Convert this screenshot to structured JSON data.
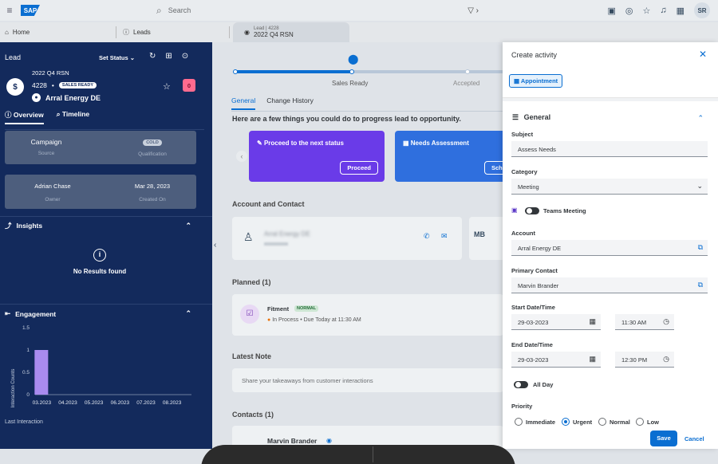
{
  "shell": {
    "logo": "SAP",
    "search_placeholder": "Search",
    "avatar": "SR"
  },
  "tabs": {
    "home": "Home",
    "leads": "Leads",
    "lead_small": "Lead | 4228",
    "lead_title": "2022 Q4 RSN"
  },
  "left": {
    "header": "Lead",
    "set_status": "Set Status",
    "lead_title": "2022 Q4 RSN",
    "lead_id": "4228",
    "status_badge": "SALES READY",
    "account": "Arral Energy DE",
    "count": "0",
    "tab_overview": "Overview",
    "tab_timeline": "Timeline",
    "campaign_value": "Campaign",
    "campaign_label": "Source",
    "qualification_value": "COLD",
    "qualification_label": "Qualification",
    "owner_value": "Adrian Chase",
    "owner_label": "Owner",
    "created_value": "Mar 28, 2023",
    "created_label": "Created On",
    "insights": "Insights",
    "no_results": "No Results found",
    "engagement": "Engagement",
    "last_interaction": "Last Interaction"
  },
  "chart_data": {
    "type": "bar",
    "categories": [
      "03.2023",
      "04.2023",
      "05.2023",
      "06.2023",
      "07.2023",
      "08.2023"
    ],
    "values": [
      1,
      0,
      0,
      0,
      0,
      0
    ],
    "ylabel": "Interaction Counts",
    "yticks": [
      "0",
      "0.5",
      "1",
      "1.5"
    ],
    "ylim": [
      0,
      1.5
    ],
    "bar_color": "#a98bef"
  },
  "mid": {
    "stage_current": "Sales Ready",
    "stage_next": "Accepted",
    "tab_general": "General",
    "tab_history": "Change History",
    "progress_heading": "Here are a few things you could do to progress lead to opportunity.",
    "action1_title": "Proceed to the next status",
    "action1_btn": "Proceed",
    "action2_title": "Needs Assessment",
    "action2_btn": "Sch",
    "account_contact": "Account and Contact",
    "account_name": "Arral Energy DE",
    "contact_initials": "MB",
    "planned": "Planned (1)",
    "planned_title": "Fitment",
    "planned_badge": "NORMAL",
    "planned_status": "In Process • Due Today at 11:30 AM",
    "latest_note": "Latest Note",
    "note_placeholder": "Share your takeaways from customer interactions",
    "contacts": "Contacts (1)",
    "contact_name": "Marvin Brander"
  },
  "dialog": {
    "title": "Create activity",
    "appointment": "Appointment",
    "general": "General",
    "subject_label": "Subject",
    "subject_value": "Assess Needs",
    "category_label": "Category",
    "category_value": "Meeting",
    "teams_label": "Teams Meeting",
    "account_label": "Account",
    "account_value": "Arral Energy DE",
    "primary_label": "Primary Contact",
    "primary_value": "Marvin Brander",
    "start_label": "Start Date/Time",
    "start_date": "29-03-2023",
    "start_time": "11:30 AM",
    "end_label": "End Date/Time",
    "end_date": "29-03-2023",
    "end_time": "12:30 PM",
    "allday": "All Day",
    "priority_label": "Priority",
    "priorities": [
      "Immediate",
      "Urgent",
      "Normal",
      "Low"
    ],
    "selected_priority": "Urgent",
    "save": "Save",
    "cancel": "Cancel"
  },
  "colors": {
    "accent": "#0a6ed1",
    "sidebar": "#132a5c",
    "purple_action": "#6a3be8",
    "blue_action": "#2f6fde"
  }
}
